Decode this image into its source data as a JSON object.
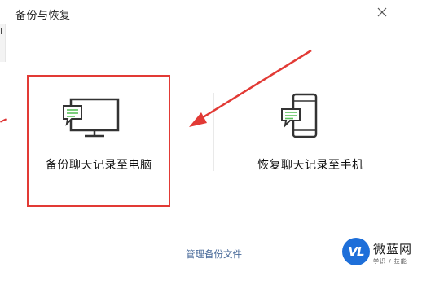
{
  "window": {
    "title": "备份与恢复",
    "close_glyph": "×"
  },
  "side_fragment": {
    "glyph": "i"
  },
  "options": [
    {
      "label": "备份聊天记录至电脑",
      "icon": "monitor-chat-icon"
    },
    {
      "label": "恢复聊天记录至手机",
      "icon": "phone-chat-icon"
    }
  ],
  "footer": {
    "manage_link": "管理备份文件"
  },
  "watermark": {
    "logo_text": "VL",
    "brand": "微蓝网",
    "tagline": "学识 / 技能"
  },
  "colors": {
    "accent_green": "#5cc25c",
    "highlight_red": "#e23a35",
    "link_blue": "#4a6b9a",
    "icon_gray": "#333333"
  }
}
